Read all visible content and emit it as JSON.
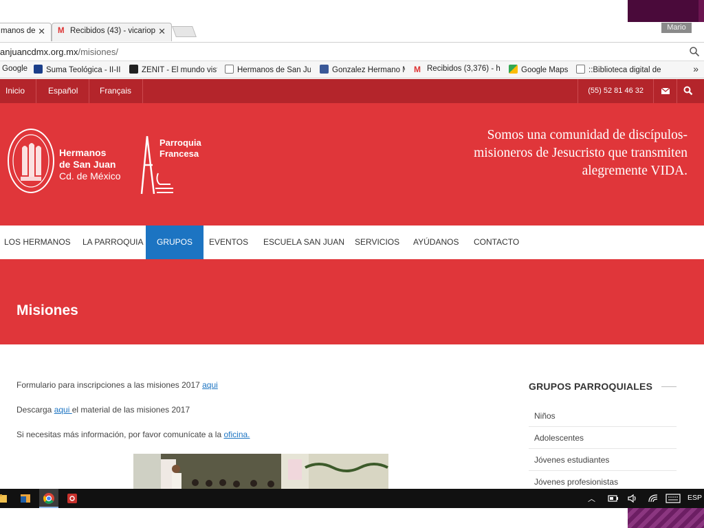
{
  "browser": {
    "tabs": [
      {
        "label": "manos de"
      },
      {
        "label": "Recibidos (43) - vicariop"
      }
    ],
    "user_badge": "Mario",
    "url_host": "anjuancdmx.org.mx",
    "url_path": "/misiones/",
    "bookmarks": [
      {
        "label": "Google"
      },
      {
        "label": "Suma Teológica - II-II"
      },
      {
        "label": "ZENIT - El mundo vist"
      },
      {
        "label": "Hermanos de San Jua"
      },
      {
        "label": "Gonzalez Hermano M"
      },
      {
        "label": "Recibidos (3,376) - hn"
      },
      {
        "label": "Google Maps"
      },
      {
        "label": "::Biblioteca digital de"
      }
    ],
    "bookmarks_more": "»"
  },
  "topbar": {
    "links": [
      "Inicio",
      "Español",
      "Français"
    ],
    "phone": "(55) 52 81 46 32"
  },
  "header": {
    "org_line1": "Hermanos",
    "org_line2": "de San Juan",
    "org_line3": "Cd. de México",
    "parish_line1": "Parroquia",
    "parish_line2": "Francesa",
    "tagline_1": "Somos una comunidad de discípulos-",
    "tagline_2": "misioneros de Jesucristo que transmiten",
    "tagline_3": "alegremente VIDA."
  },
  "nav": {
    "items": [
      "LOS HERMANOS",
      "LA PARROQUIA",
      "GRUPOS",
      "EVENTOS",
      "ESCUELA SAN JUAN",
      "SERVICIOS",
      "AYÚDANOS",
      "CONTACTO"
    ],
    "active": "GRUPOS"
  },
  "page": {
    "title": "Misiones",
    "p1_text": "Formulario para inscripciones a las misiones 2017 ",
    "p1_link": "aqui",
    "p2_text_before": "Descarga ",
    "p2_link": "aqui ",
    "p2_text_after": "el material de las misiones 2017",
    "p3_text": "Si necesitas más información, por favor comunícate a la ",
    "p3_link": "oficina."
  },
  "sidebar": {
    "title": "GRUPOS PARROQUIALES",
    "items": [
      "Niños",
      "Adolescentes",
      "Jóvenes estudiantes",
      "Jóvenes profesionistas"
    ]
  },
  "taskbar": {
    "language": "ESP"
  },
  "colors": {
    "brand_red": "#e0363a",
    "topbar_red": "#b4252b",
    "active_blue": "#1c74c2"
  }
}
